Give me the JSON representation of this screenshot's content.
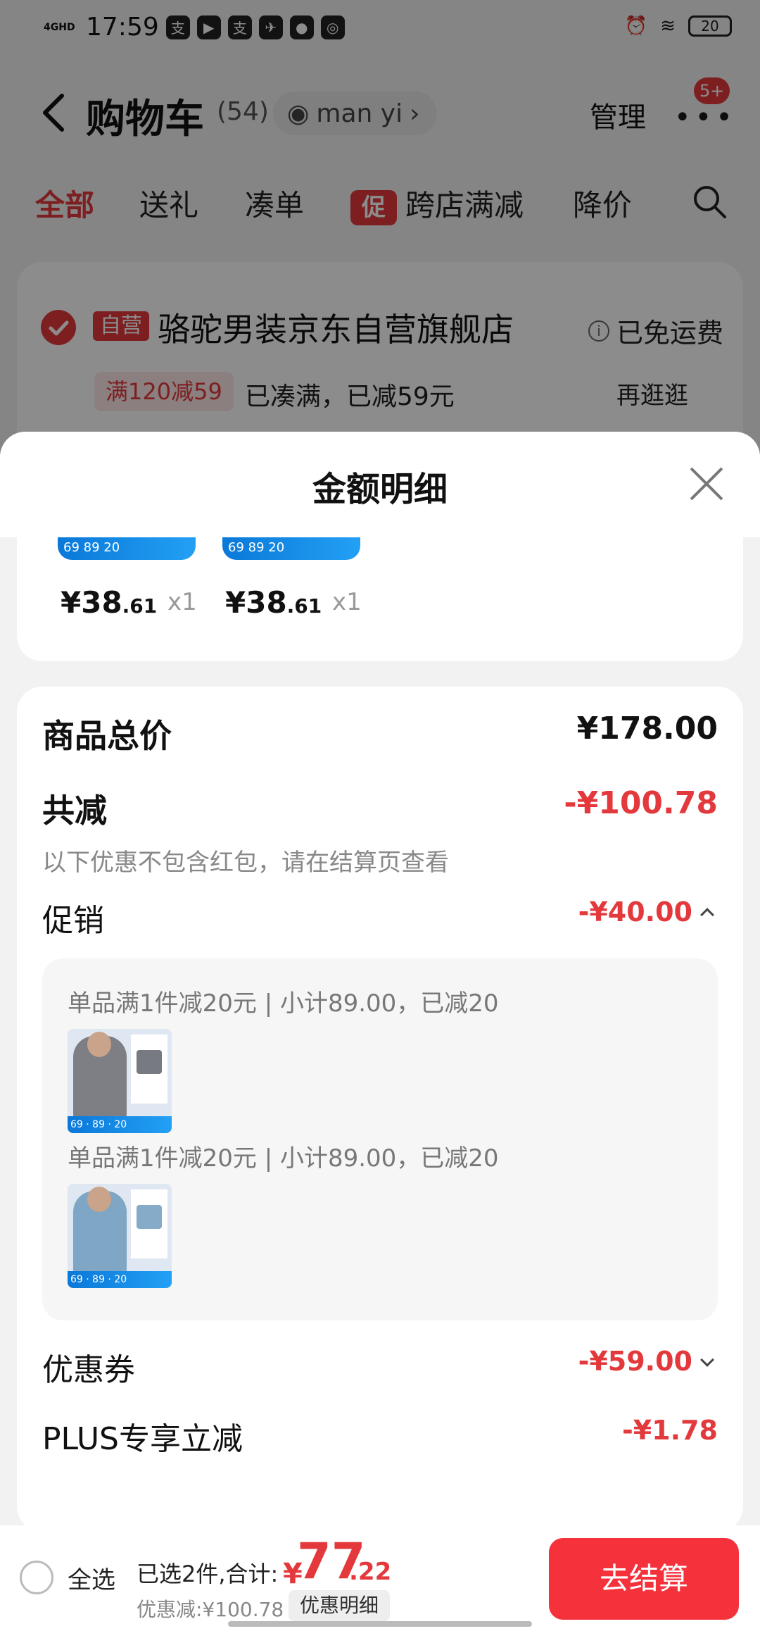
{
  "status_bar": {
    "network": "4GHD",
    "time": "17:59",
    "battery": "20",
    "app_icons": [
      "alipay-icon",
      "video-icon",
      "alipay-icon",
      "bird-icon",
      "chat-icon",
      "app-icon"
    ]
  },
  "nav": {
    "title": "购物车",
    "count": "(54)",
    "user": "man yi",
    "manage": "管理",
    "more_badge": "5+"
  },
  "tabs": {
    "all": "全部",
    "gift": "送礼",
    "bundle": "凑单",
    "promo_tag": "促",
    "cross_store": "跨店满减",
    "price_drop": "降价"
  },
  "store": {
    "self_tag": "自营",
    "name": "骆驼男装京东自营旗舰店",
    "shipping": "已免运费",
    "promo_chip": "满120减59",
    "promo_status": "已凑满，已减59元",
    "browse_more": "再逛逛"
  },
  "sheet": {
    "title": "金额明细",
    "items": [
      {
        "price_int": "¥38",
        "price_dec": ".61",
        "qty": "x1",
        "band_price": "69",
        "band_a": "89",
        "band_b": "20"
      },
      {
        "price_int": "¥38",
        "price_dec": ".61",
        "qty": "x1",
        "band_price": "69",
        "band_a": "89",
        "band_b": "20"
      }
    ],
    "subtotal_label": "商品总价",
    "subtotal_value": "¥178.00",
    "discount_label": "共减",
    "discount_value": "-¥100.78",
    "discount_note": "以下优惠不包含红包，请在结算页查看",
    "promo_label": "促销",
    "promo_value": "-¥40.00",
    "promo_lines": [
      "单品满1件减20元 | 小计89.00，已减20",
      "单品满1件减20元 | 小计89.00，已减20"
    ],
    "coupon_label": "优惠券",
    "coupon_value": "-¥59.00",
    "plus_label": "PLUS专享立减",
    "plus_value": "-¥1.78"
  },
  "bottom_bar": {
    "select_all": "全选",
    "selected": "已选2件,合计:",
    "yen": "¥",
    "total_int": "77",
    "total_dec": ".22",
    "discount_text": "优惠减:¥100.78",
    "detail_button": "优惠明细",
    "checkout": "去结算"
  },
  "colors": {
    "accent": "#e4393c",
    "checkout": "#f5313c"
  }
}
